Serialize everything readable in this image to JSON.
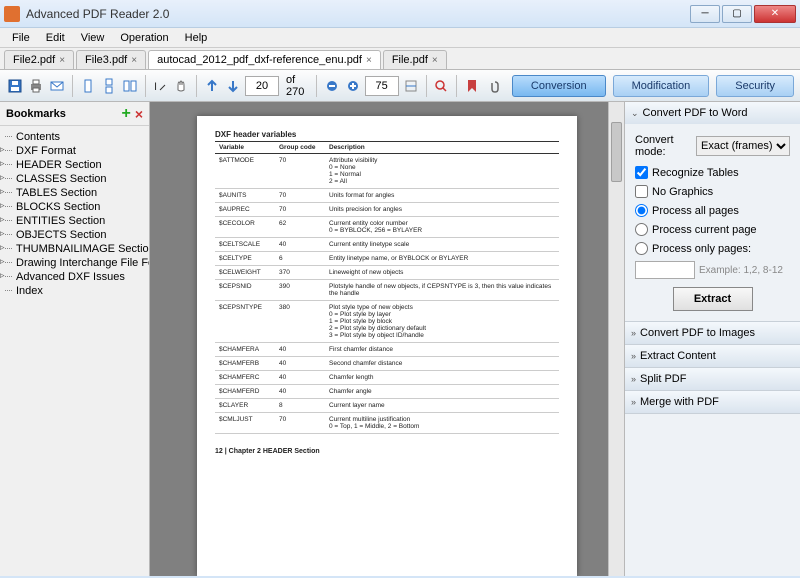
{
  "window": {
    "title": "Advanced PDF Reader 2.0"
  },
  "menu": [
    "File",
    "Edit",
    "View",
    "Operation",
    "Help"
  ],
  "tabs": [
    {
      "label": "File2.pdf",
      "active": false
    },
    {
      "label": "File3.pdf",
      "active": false
    },
    {
      "label": "autocad_2012_pdf_dxf-reference_enu.pdf",
      "active": true
    },
    {
      "label": "File.pdf",
      "active": false
    }
  ],
  "toolbar": {
    "page_current": "20",
    "page_total": "of 270",
    "zoom": "75",
    "buttons": {
      "conversion": "Conversion",
      "modification": "Modification",
      "security": "Security"
    }
  },
  "sidebar": {
    "title": "Bookmarks",
    "items": [
      "Contents",
      "DXF Format",
      "HEADER Section",
      "CLASSES Section",
      "TABLES Section",
      "BLOCKS Section",
      "ENTITIES Section",
      "OBJECTS Section",
      "THUMBNAILIMAGE Section",
      "Drawing Interchange File Formats",
      "Advanced DXF Issues",
      "Index"
    ]
  },
  "doc": {
    "heading": "DXF header variables",
    "cols": [
      "Variable",
      "Group code",
      "Description"
    ],
    "rows": [
      [
        "$ATTMODE",
        "70",
        "Attribute visibility\n0 = None\n1 = Normal\n2 = All"
      ],
      [
        "$AUNITS",
        "70",
        "Units format for angles"
      ],
      [
        "$AUPREC",
        "70",
        "Units precision for angles"
      ],
      [
        "$CECOLOR",
        "62",
        "Current entity color number\n0 = BYBLOCK, 256 = BYLAYER"
      ],
      [
        "$CELTSCALE",
        "40",
        "Current entity linetype scale"
      ],
      [
        "$CELTYPE",
        "6",
        "Entity linetype name, or BYBLOCK or BYLAYER"
      ],
      [
        "$CELWEIGHT",
        "370",
        "Lineweight of new objects"
      ],
      [
        "$CEPSNID",
        "390",
        "Plotstyle handle of new objects, if CEPSNTYPE is 3, then this value indicates the handle"
      ],
      [
        "$CEPSNTYPE",
        "380",
        "Plot style type of new objects\n0 = Plot style by layer\n1 = Plot style by block\n2 = Plot style by dictionary default\n3 = Plot style by object ID/handle"
      ],
      [
        "$CHAMFERA",
        "40",
        "First chamfer distance"
      ],
      [
        "$CHAMFERB",
        "40",
        "Second chamfer distance"
      ],
      [
        "$CHAMFERC",
        "40",
        "Chamfer length"
      ],
      [
        "$CHAMFERD",
        "40",
        "Chamfer angle"
      ],
      [
        "$CLAYER",
        "8",
        "Current layer name"
      ],
      [
        "$CMLJUST",
        "70",
        "Current multiline justification\n0 = Top, 1 = Middle, 2 = Bottom"
      ]
    ],
    "footer": "12 | Chapter 2   HEADER Section"
  },
  "panel": {
    "sections": [
      "Convert PDF to Word",
      "Convert PDF to Images",
      "Extract Content",
      "Split PDF",
      "Merge with PDF"
    ],
    "convert": {
      "mode_label": "Convert mode:",
      "mode_value": "Exact (frames)",
      "recognize": "Recognize Tables",
      "nographics": "No Graphics",
      "all": "Process all pages",
      "current": "Process current page",
      "only": "Process only pages:",
      "example": "Example: 1,2, 8-12",
      "extract": "Extract"
    }
  }
}
